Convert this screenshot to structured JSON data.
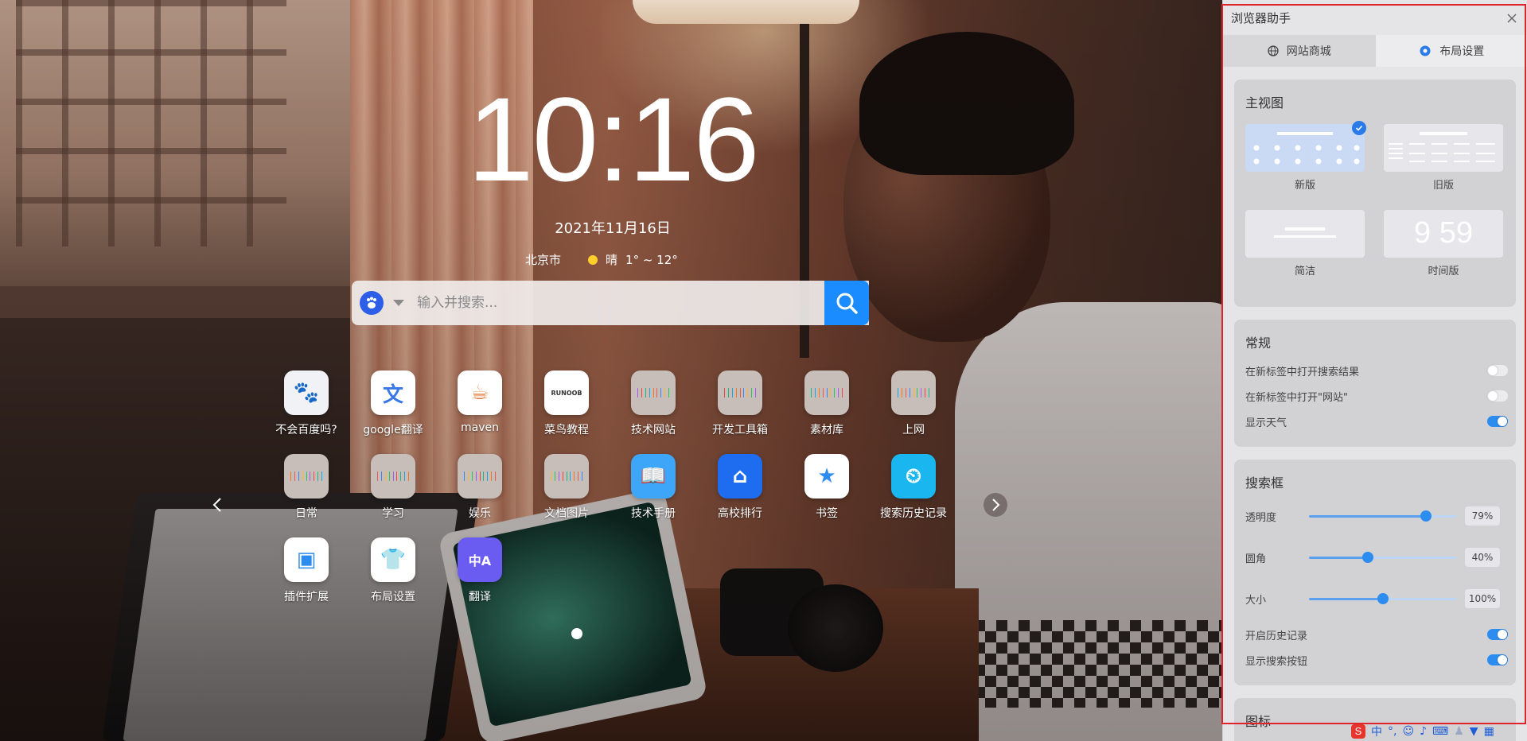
{
  "clock": {
    "time": "10:16",
    "date": "2021年11月16日"
  },
  "weather": {
    "city": "北京市",
    "condition": "晴",
    "range": "1° ~ 12°"
  },
  "search": {
    "placeholder": "输入并搜索..."
  },
  "apps": [
    {
      "label": "不会百度吗?",
      "icon": "baidu-paw-icon",
      "color": "#f1f2f6"
    },
    {
      "label": "google翻译",
      "icon": "google-translate-icon",
      "color": "#ffffff"
    },
    {
      "label": "maven",
      "icon": "jar-icon",
      "color": "#ffffff"
    },
    {
      "label": "菜鸟教程",
      "icon": "runoob-icon",
      "color": "#ffffff"
    },
    {
      "label": "技术网站",
      "icon": "folder-icon",
      "color": "#c8beb9"
    },
    {
      "label": "开发工具箱",
      "icon": "folder-icon",
      "color": "#c8beb9"
    },
    {
      "label": "素材库",
      "icon": "folder-icon",
      "color": "#c8beb9"
    },
    {
      "label": "上网",
      "icon": "folder-icon",
      "color": "#c8beb9"
    },
    {
      "label": "日常",
      "icon": "folder-icon",
      "color": "#c8beb9"
    },
    {
      "label": "学习",
      "icon": "folder-icon",
      "color": "#c8beb9"
    },
    {
      "label": "娱乐",
      "icon": "folder-icon",
      "color": "#c8beb9"
    },
    {
      "label": "文档图片",
      "icon": "folder-icon",
      "color": "#c8beb9"
    },
    {
      "label": "技术手册",
      "icon": "manual-icon",
      "color": "#3ea6f8"
    },
    {
      "label": "高校排行",
      "icon": "university-icon",
      "color": "#1e6df0"
    },
    {
      "label": "书签",
      "icon": "star-icon",
      "color": "#ffffff"
    },
    {
      "label": "搜索历史记录",
      "icon": "history-icon",
      "color": "#19b6f0"
    },
    {
      "label": "插件扩展",
      "icon": "bag-icon",
      "color": "#ffffff"
    },
    {
      "label": "布局设置",
      "icon": "shirt-icon",
      "color": "#ffffff"
    },
    {
      "label": "翻译",
      "icon": "translate-icon",
      "color": "#6a5cf0"
    }
  ],
  "panel": {
    "title": "浏览器助手",
    "tabs": [
      {
        "label": "网站商城",
        "icon": "globe-icon"
      },
      {
        "label": "布局设置",
        "icon": "gear-icon"
      }
    ],
    "main_view": {
      "heading": "主视图",
      "options": [
        {
          "label": "新版",
          "selected": true
        },
        {
          "label": "旧版",
          "selected": false
        },
        {
          "label": "简洁",
          "selected": false
        },
        {
          "label": "时间版",
          "selected": false
        }
      ],
      "time_preview": "9 59"
    },
    "general": {
      "heading": "常规",
      "items": [
        {
          "label": "在新标签中打开搜索结果",
          "on": false
        },
        {
          "label": "在新标签中打开\"网站\"",
          "on": false
        },
        {
          "label": "显示天气",
          "on": true
        }
      ]
    },
    "searchbox": {
      "heading": "搜索框",
      "sliders": [
        {
          "label": "透明度",
          "value": 79,
          "display": "79%"
        },
        {
          "label": "圆角",
          "value": 40,
          "display": "40%"
        },
        {
          "label": "大小",
          "value": 50,
          "display": "100%"
        }
      ],
      "toggles": [
        {
          "label": "开启历史记录",
          "on": true
        },
        {
          "label": "显示搜索按钮",
          "on": true
        }
      ]
    },
    "icons_heading": "图标"
  },
  "taskbar": {
    "ime_label": "中"
  },
  "colors": {
    "accent": "#2d8cf0",
    "search_button": "#1a8cff",
    "outline": "#e0242b"
  }
}
